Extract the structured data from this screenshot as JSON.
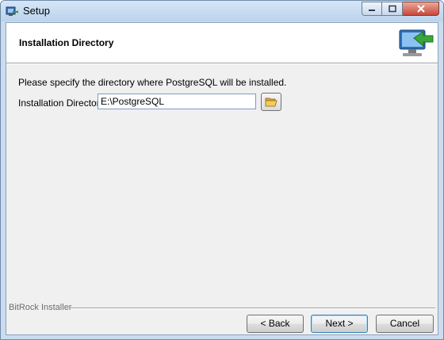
{
  "window": {
    "title": "Setup"
  },
  "header": {
    "title": "Installation Directory",
    "logo_icon": "installer-computer-arrow-icon"
  },
  "main": {
    "description": "Please specify the directory where PostgreSQL will be installed.",
    "dir_label": "Installation Directory",
    "dir_value": "E:\\PostgreSQL",
    "browse_icon": "folder-open-icon"
  },
  "footer": {
    "brand": "BitRock Installer",
    "back_label": "< Back",
    "next_label": "Next >",
    "cancel_label": "Cancel"
  },
  "colors": {
    "titlebar": "#c9dcf0",
    "header_bg": "#ffffff",
    "dialog_bg": "#f0f0f0",
    "close_button": "#c8483a"
  }
}
